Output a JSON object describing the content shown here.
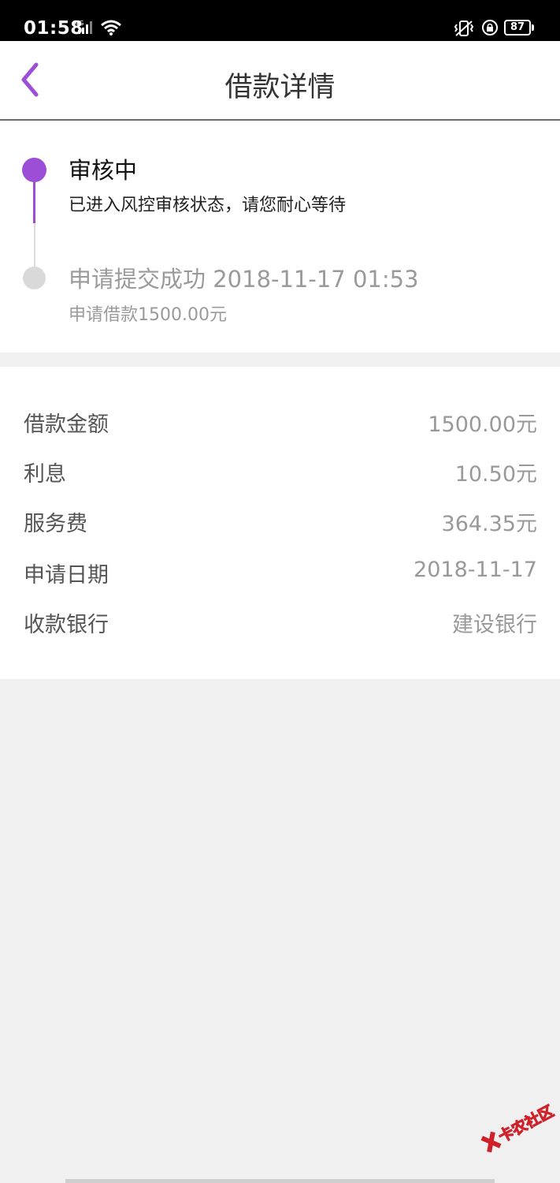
{
  "status_bar": {
    "time": "01:58",
    "network": "4G",
    "battery": "87"
  },
  "header": {
    "title": "借款详情",
    "back_icon": "chevron-left-icon",
    "accent_color": "#9c4fd6"
  },
  "timeline": {
    "steps": [
      {
        "title": "审核中",
        "desc": "已进入风控审核状态，请您耐心等待",
        "active": true
      },
      {
        "title": "申请提交成功 2018-11-17 01:53",
        "desc": "申请借款1500.00元",
        "active": false
      }
    ]
  },
  "details": {
    "rows": [
      {
        "label": "借款金额",
        "value": "1500.00元"
      },
      {
        "label": "利息",
        "value": "10.50元"
      },
      {
        "label": "服务费",
        "value": "364.35元"
      },
      {
        "label": "申请日期",
        "value": "2018-11-17"
      },
      {
        "label": "收款银行",
        "value": "建设银行"
      }
    ]
  },
  "watermark": {
    "text": "卡农社区"
  }
}
